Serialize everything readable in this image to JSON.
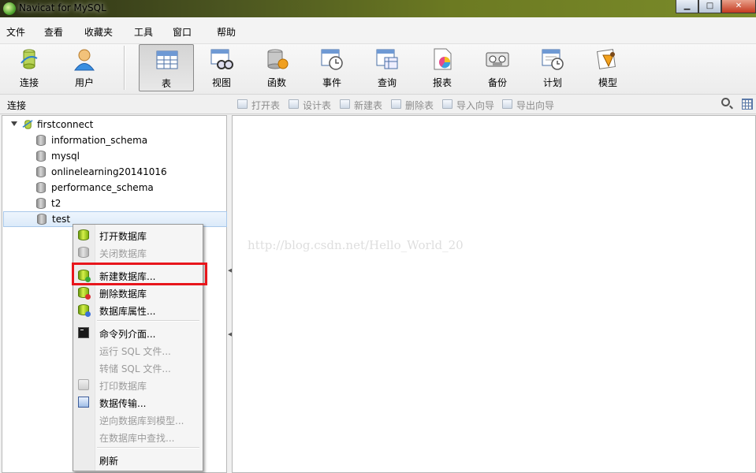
{
  "window": {
    "title": "Navicat for MySQL"
  },
  "menubar": {
    "items": [
      "文件",
      "查看",
      "收藏夹",
      "工具",
      "窗口",
      "帮助"
    ]
  },
  "toolbar": {
    "buttons": [
      {
        "label": "连接",
        "icon": "connection-icon"
      },
      {
        "label": "用户",
        "icon": "user-icon"
      },
      {
        "label": "表",
        "icon": "table-icon",
        "active": true
      },
      {
        "label": "视图",
        "icon": "view-icon"
      },
      {
        "label": "函数",
        "icon": "function-icon"
      },
      {
        "label": "事件",
        "icon": "event-icon"
      },
      {
        "label": "查询",
        "icon": "query-icon"
      },
      {
        "label": "报表",
        "icon": "report-icon"
      },
      {
        "label": "备份",
        "icon": "backup-icon"
      },
      {
        "label": "计划",
        "icon": "schedule-icon"
      },
      {
        "label": "模型",
        "icon": "model-icon"
      }
    ]
  },
  "subbar": {
    "section_label": "连接",
    "actions": [
      "打开表",
      "设计表",
      "新建表",
      "删除表",
      "导入向导",
      "导出向导"
    ]
  },
  "tree": {
    "connection": "firstconnect",
    "databases": [
      "information_schema",
      "mysql",
      "onlinelearning20141016",
      "performance_schema",
      "t2",
      "test"
    ],
    "selected": "test"
  },
  "context_menu": {
    "items": [
      {
        "label": "打开数据库",
        "enabled": true
      },
      {
        "label": "关闭数据库",
        "enabled": false
      },
      {
        "label": "新建数据库...",
        "enabled": true,
        "highlighted": true
      },
      {
        "label": "删除数据库",
        "enabled": true
      },
      {
        "label": "数据库属性...",
        "enabled": true
      },
      {
        "label": "命令列介面...",
        "enabled": true
      },
      {
        "label": "运行 SQL 文件...",
        "enabled": false
      },
      {
        "label": "转储 SQL 文件...",
        "enabled": false
      },
      {
        "label": "打印数据库",
        "enabled": false
      },
      {
        "label": "数据传输...",
        "enabled": true
      },
      {
        "label": "逆向数据库到模型...",
        "enabled": false
      },
      {
        "label": "在数据库中查找...",
        "enabled": false
      },
      {
        "label": "刷新",
        "enabled": true
      }
    ]
  },
  "watermark": "http://blog.csdn.net/Hello_World_20",
  "colors": {
    "highlight_border": "#e8161c",
    "title_bar": "#6c7a22"
  }
}
